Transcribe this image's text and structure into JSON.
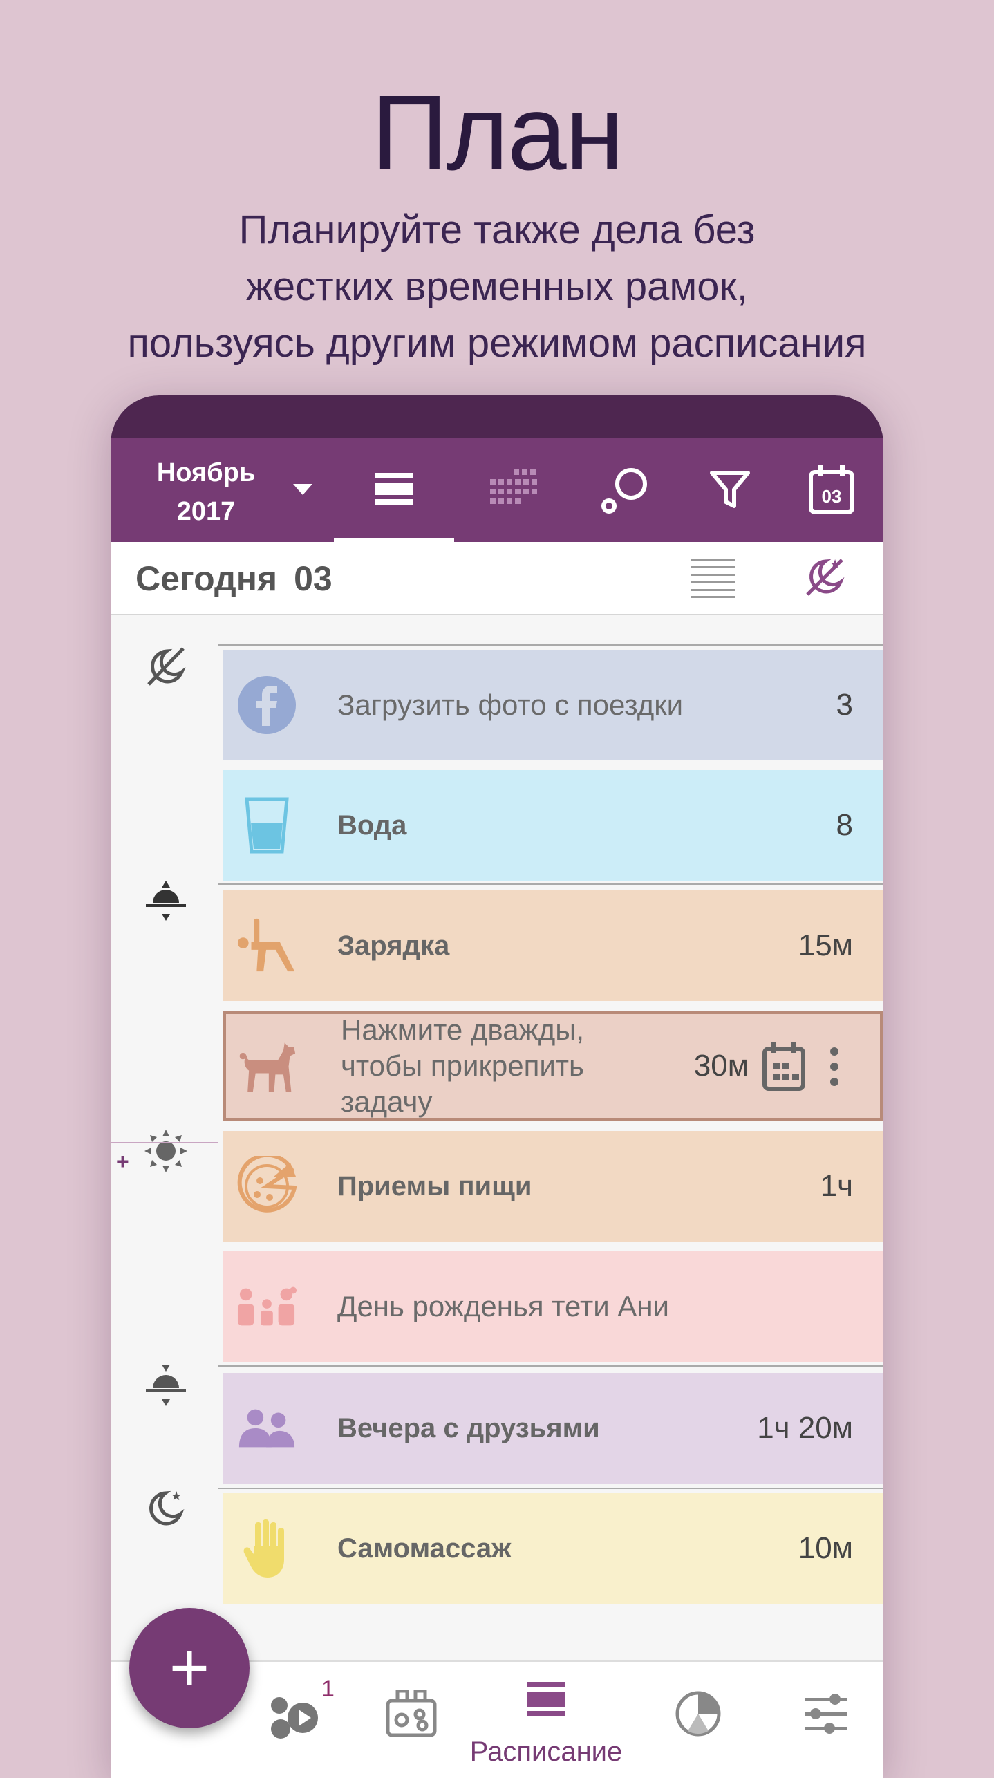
{
  "hero": {
    "title": "План",
    "subtitle_lines": [
      "Планируйте также дела без",
      "жестких временных рамок,",
      "пользуясь другим режимом расписания"
    ]
  },
  "toolbar": {
    "month": "Ноябрь",
    "year": "2017",
    "calendar_day": "03",
    "icons": [
      "dropdown-arrow-icon",
      "schedule-list-icon",
      "calendar-grid-icon",
      "search-icon",
      "filter-icon",
      "calendar-today-icon"
    ]
  },
  "today": {
    "label": "Сегодня",
    "day": "03"
  },
  "tasks": [
    {
      "label": "Загрузить фото с поездки",
      "duration": "3",
      "icon": "facebook-icon",
      "bg": "#d2d9e8",
      "bold": false
    },
    {
      "label": "Вода",
      "duration": "8",
      "icon": "water-glass-icon",
      "bg": "#ccedf8",
      "bold": true
    },
    {
      "label": "Зарядка",
      "duration": "15м",
      "icon": "exercise-icon",
      "bg": "#f2d9c3",
      "bold": true
    },
    {
      "label": "Нажмите дважды, чтобы прикрепить задачу",
      "duration": "30м",
      "icon": "dog-icon",
      "bg": "#ebd0c6",
      "bold": false
    },
    {
      "label": "Приемы пищи",
      "duration": "1ч",
      "icon": "pizza-icon",
      "bg": "#f2d9c3",
      "bold": true
    },
    {
      "label": "День рожденья тети Ани",
      "duration": "",
      "icon": "family-icon",
      "bg": "#f9d8d8",
      "bold": false
    },
    {
      "label": "Вечера с друзьями",
      "duration": "1ч 20м",
      "icon": "friends-icon",
      "bg": "#e3d5e7",
      "bold": true
    },
    {
      "label": "Самомассаж",
      "duration": "10м",
      "icon": "hand-icon",
      "bg": "#f9f0cc",
      "bold": true
    }
  ],
  "fab": {
    "label": "+"
  },
  "bottom_nav": {
    "badge": "1",
    "active_label": "Расписание",
    "items": [
      "activities-icon",
      "routines-icon",
      "schedule-icon",
      "statistics-icon",
      "settings-icon"
    ]
  },
  "colors": {
    "accent": "#763b74",
    "status_bar": "#4e2650",
    "background": "#dec5d1"
  }
}
